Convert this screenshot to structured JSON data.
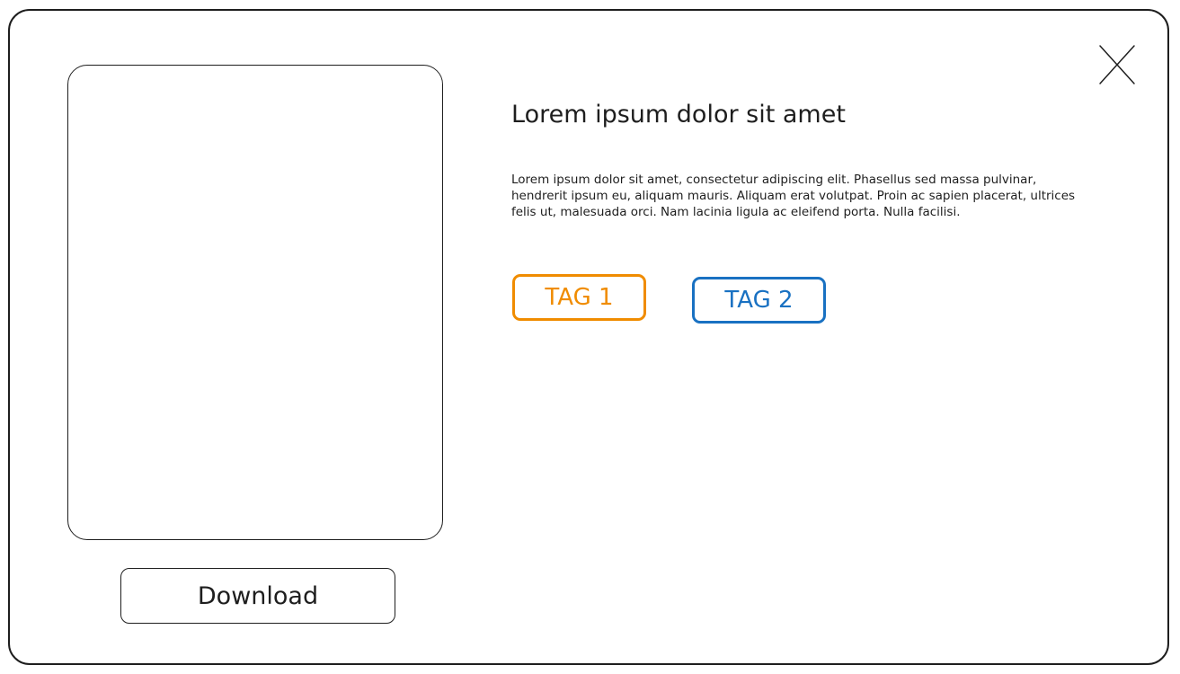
{
  "modal": {
    "close_icon": "close-icon",
    "image_placeholder": "image-placeholder",
    "download_label": "Download",
    "title": "Lorem ipsum dolor sit amet",
    "description": "Lorem ipsum dolor sit amet, consectetur adipiscing elit. Phasellus sed massa pulvinar, hendrerit ipsum eu, aliquam mauris. Aliquam erat volutpat. Proin ac sapien placerat, ultrices felis ut, malesuada orci. Nam lacinia ligula ac eleifend porta. Nulla facilisi.",
    "tags": [
      {
        "label": "TAG 1",
        "color": "#f08c00"
      },
      {
        "label": "TAG 2",
        "color": "#1971c2"
      }
    ]
  },
  "colors": {
    "stroke": "#1e1e1e",
    "background": "#ffffff"
  }
}
